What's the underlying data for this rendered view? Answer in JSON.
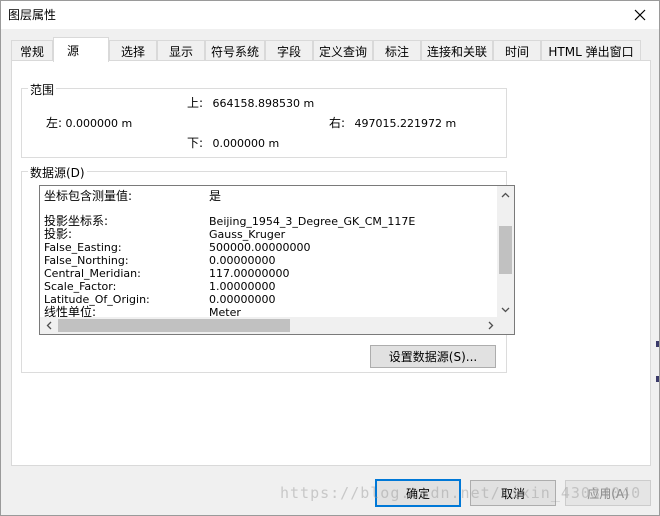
{
  "window": {
    "title": "图层属性"
  },
  "tabs": [
    {
      "label": "常规"
    },
    {
      "label": "源"
    },
    {
      "label": "选择"
    },
    {
      "label": "显示"
    },
    {
      "label": "符号系统"
    },
    {
      "label": "字段"
    },
    {
      "label": "定义查询"
    },
    {
      "label": "标注"
    },
    {
      "label": "连接和关联"
    },
    {
      "label": "时间"
    },
    {
      "label": "HTML 弹出窗口"
    }
  ],
  "active_tab": "源",
  "extent": {
    "label": "范围",
    "top_label": "上:",
    "top_value": "664158.898530 m",
    "left_label": "左:",
    "left_value": "0.000000 m",
    "right_label": "右:",
    "right_value": "497015.221972 m",
    "bottom_label": "下:",
    "bottom_value": "0.000000 m"
  },
  "datasource": {
    "label": "数据源(D)",
    "rows": [
      {
        "key": "坐标包含测量值:",
        "value": "是"
      },
      {
        "key": "投影坐标系:",
        "value": "Beijing_1954_3_Degree_GK_CM_117E"
      },
      {
        "key": "投影:",
        "value": "Gauss_Kruger"
      },
      {
        "key": "False_Easting:",
        "value": "500000.00000000"
      },
      {
        "key": "False_Northing:",
        "value": "0.00000000"
      },
      {
        "key": "Central_Meridian:",
        "value": "117.00000000"
      },
      {
        "key": "Scale_Factor:",
        "value": "1.00000000"
      },
      {
        "key": "Latitude_Of_Origin:",
        "value": "0.00000000"
      },
      {
        "key": "线性单位:",
        "value": "Meter"
      }
    ],
    "set_button": "设置数据源(S)..."
  },
  "buttons": {
    "ok": "确定",
    "cancel": "取消",
    "apply": "应用(A)"
  },
  "watermark": "https://blog.csdn.net/xixin_43034040"
}
